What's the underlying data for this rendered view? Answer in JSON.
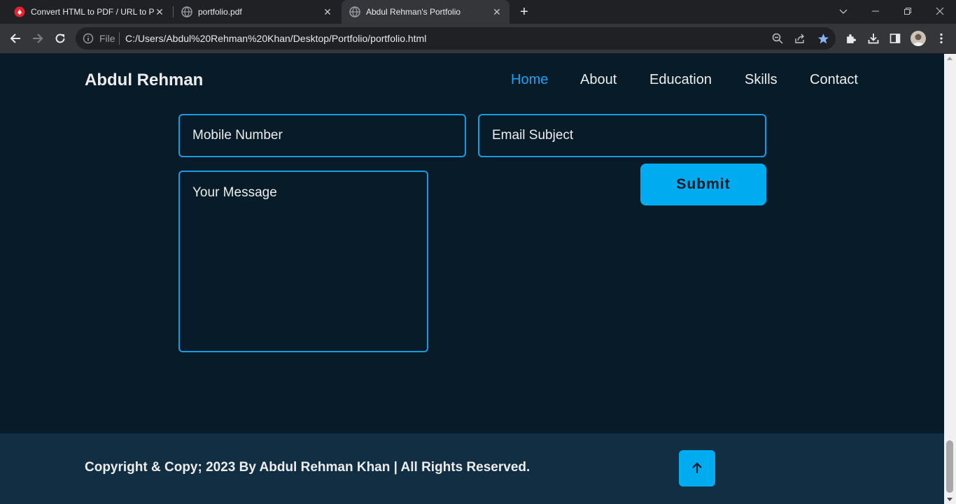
{
  "browser": {
    "tabs": [
      {
        "label": "Convert HTML to PDF / URL to PDF",
        "icon": "pdf-converter-icon",
        "active": false
      },
      {
        "label": "portfolio.pdf",
        "icon": "globe-icon",
        "active": false
      },
      {
        "label": "Abdul Rehman's Portfolio",
        "icon": "globe-icon",
        "active": true
      }
    ],
    "address": {
      "scheme_label": "File",
      "url": "C:/Users/Abdul%20Rehman%20Khan/Desktop/Portfolio/portfolio.html"
    }
  },
  "header": {
    "logo": "Abdul Rehman",
    "nav": [
      {
        "label": "Home",
        "current": true
      },
      {
        "label": "About"
      },
      {
        "label": "Education"
      },
      {
        "label": "Skills"
      },
      {
        "label": "Contact"
      }
    ]
  },
  "contact_form": {
    "mobile_placeholder": "Mobile Number",
    "subject_placeholder": "Email Subject",
    "message_placeholder": "Your Message",
    "submit_label": "Submit"
  },
  "footer": {
    "copyright": "Copyright & Copy; 2023 By Abdul Rehman Khan | All Rights Reserved.",
    "back_to_top_icon": "arrow-up-icon"
  },
  "colors": {
    "background": "#081b29",
    "footer_background": "#112e42",
    "accent": "#00abf0",
    "nav_active": "#1da1f2",
    "text": "#ededed"
  }
}
